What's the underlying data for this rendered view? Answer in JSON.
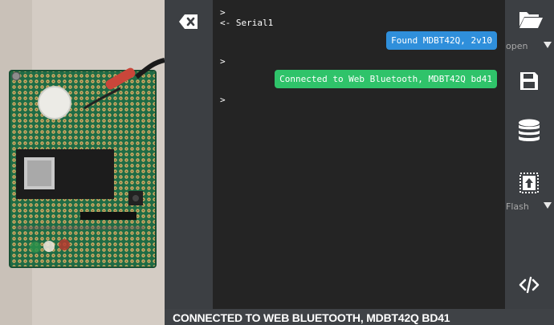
{
  "terminal": {
    "lines": [
      ">",
      "<- Serial1",
      ">",
      ">"
    ],
    "messages": [
      {
        "text": "Found MDBT42Q, 2v10",
        "color": "#2f8fdb"
      },
      {
        "text": "Connected to Web Bluetooth, MDBT42Q bd41",
        "color": "#2fc36a"
      }
    ]
  },
  "toolbar": {
    "open_label": "open",
    "flash_label": "Flash"
  },
  "status": {
    "text": "CONNECTED TO WEB BLUETOOTH, MDBT42Q BD41"
  },
  "icons": {
    "clear": "backspace-icon",
    "open": "folder-open-icon",
    "save": "floppy-disk-icon",
    "storage": "database-icon",
    "flash": "upload-chip-icon",
    "code": "code-icon"
  }
}
